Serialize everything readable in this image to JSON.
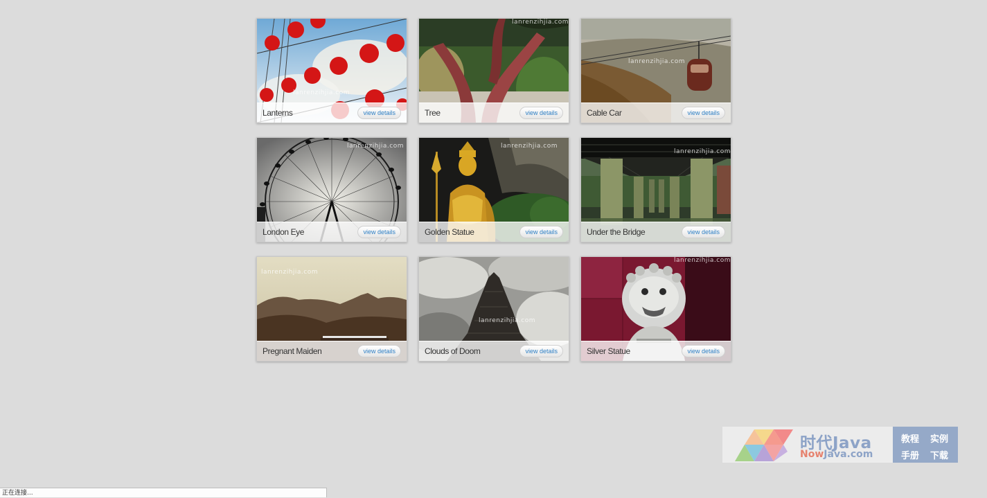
{
  "gallery": {
    "watermark": "lanrenzihjia.com",
    "items": [
      {
        "title": "Lanterns",
        "button": "view details",
        "photo_icon": "lanterns-photo"
      },
      {
        "title": "Tree",
        "button": "view details",
        "photo_icon": "tree-photo"
      },
      {
        "title": "Cable Car",
        "button": "view details",
        "photo_icon": "cable-car-photo"
      },
      {
        "title": "London Eye",
        "button": "view details",
        "photo_icon": "ferris-wheel-photo"
      },
      {
        "title": "Golden Statue",
        "button": "view details",
        "photo_icon": "golden-statue-photo"
      },
      {
        "title": "Under the Bridge",
        "button": "view details",
        "photo_icon": "bridge-photo"
      },
      {
        "title": "Pregnant Maiden",
        "button": "view details",
        "photo_icon": "mountains-photo"
      },
      {
        "title": "Clouds of Doom",
        "button": "view details",
        "photo_icon": "temple-clouds-photo"
      },
      {
        "title": "Silver Statue",
        "button": "view details",
        "photo_icon": "lion-statue-photo"
      }
    ]
  },
  "promo": {
    "brand": "时代Java",
    "url_prefix": "Now",
    "url_rest": "Java.com",
    "links": [
      "教程",
      "实例",
      "手册",
      "下载"
    ]
  },
  "status_bar": {
    "text": "正在连接..."
  },
  "colors": {
    "background": "#dcdcdc",
    "button_text": "#2e7fc4",
    "promo_blue": "#95a9c8"
  }
}
